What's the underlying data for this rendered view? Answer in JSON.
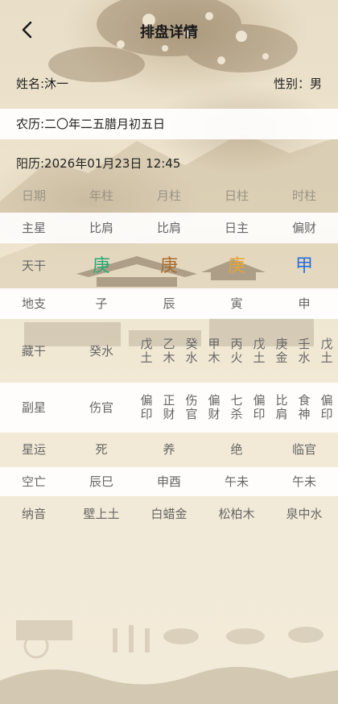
{
  "header": {
    "title": "排盘详情"
  },
  "person": {
    "name": "姓名:沐一",
    "gender": "性别：男"
  },
  "dates": {
    "lunar": "农历:二〇年二五腊月初五日",
    "solar": "阳历:2026年01月23日 12:45"
  },
  "table": {
    "headers": [
      "日期",
      "年柱",
      "月柱",
      "日柱",
      "时柱"
    ],
    "zhuxing": [
      "主星",
      "比肩",
      "比肩",
      "日主",
      "偏财"
    ],
    "tiangan": {
      "label": "天干",
      "values": [
        "庚",
        "庚",
        "庚",
        "甲"
      ],
      "colors": [
        "#2aa876",
        "#a86a2c",
        "#e5a53a",
        "#2a6fd6"
      ]
    },
    "dizhi": [
      "地支",
      "子",
      "辰",
      "寅",
      "申"
    ],
    "canggan": {
      "label": "藏干",
      "values": [
        [
          "癸水"
        ],
        [
          "戊土",
          "乙木",
          "癸水"
        ],
        [
          "甲木",
          "丙火",
          "戊土"
        ],
        [
          "庚金",
          "壬水",
          "戊土"
        ]
      ]
    },
    "fuxing": {
      "label": "副星",
      "values": [
        [
          "伤官"
        ],
        [
          "偏印",
          "正财",
          "伤官"
        ],
        [
          "偏财",
          "七杀",
          "偏印"
        ],
        [
          "比肩",
          "食神",
          "偏印"
        ]
      ]
    },
    "xingyun": [
      "星运",
      "死",
      "养",
      "绝",
      "临官"
    ],
    "kongwang": [
      "空亡",
      "辰巳",
      "申酉",
      "午未",
      "午未"
    ],
    "nayin": [
      "纳音",
      "壁上土",
      "白蜡金",
      "松柏木",
      "泉中水"
    ]
  }
}
